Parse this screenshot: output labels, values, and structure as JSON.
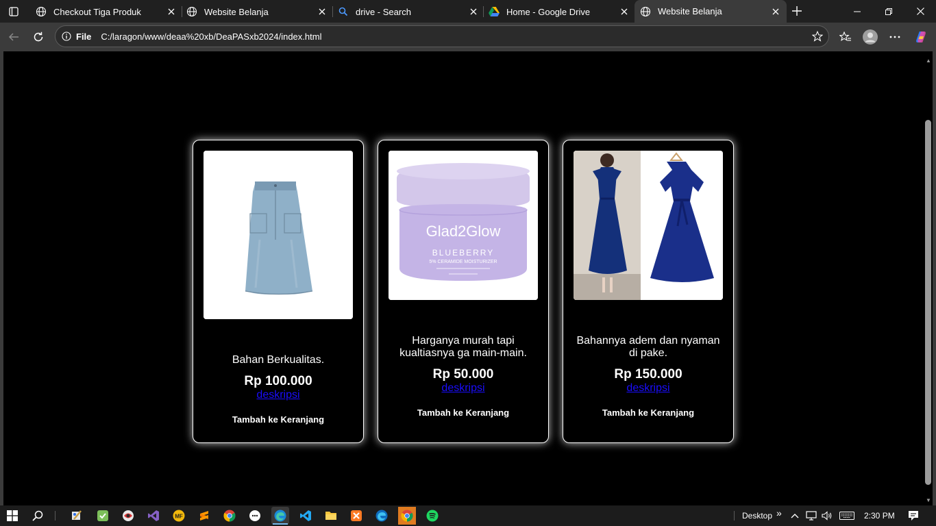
{
  "tabs": [
    {
      "title": "Checkout Tiga Produk",
      "icon": "globe-icon"
    },
    {
      "title": "Website Belanja",
      "icon": "globe-icon"
    },
    {
      "title": "drive - Search",
      "icon": "search-icon"
    },
    {
      "title": "Home - Google Drive",
      "icon": "google-drive-icon"
    },
    {
      "title": "Website Belanja",
      "icon": "globe-icon",
      "active": true
    }
  ],
  "address_bar": {
    "scheme": "File",
    "url": "C:/laragon/www/deaa%20xb/DeaPASxb2024/index.html"
  },
  "products": [
    {
      "name": "denim skirt",
      "description": "Bahan Berkualitas.",
      "price": "Rp 100.000",
      "link": "deskripsi",
      "cart": "Tambah ke Keranjang"
    },
    {
      "name": "Glad2Glow moisturizer",
      "description": "Harganya murah tapi kualtiasnya ga main-main.",
      "price": "Rp 50.000",
      "link": "deskripsi",
      "cart": "Tambah ke Keranjang"
    },
    {
      "name": "navy dress",
      "description": "Bahannya adem dan nyaman di pake.",
      "price": "Rp 150.000",
      "link": "deskripsi",
      "cart": "Tambah ke Keranjang"
    }
  ],
  "product_art": {
    "jar_brand": "Glad2Glow",
    "jar_variant": "BLUEBERRY",
    "jar_subtitle": "5% CERAMIDE MOISTURIZER"
  },
  "taskbar": {
    "desktop_label": "Desktop",
    "overflow": "»",
    "time": "2:30 PM"
  },
  "colors": {
    "page_bg": "#000000",
    "link": "#1a0dff",
    "card_border": "#ffffff",
    "chrome_bg": "#202020",
    "toolbar_bg": "#3b3b3b"
  }
}
